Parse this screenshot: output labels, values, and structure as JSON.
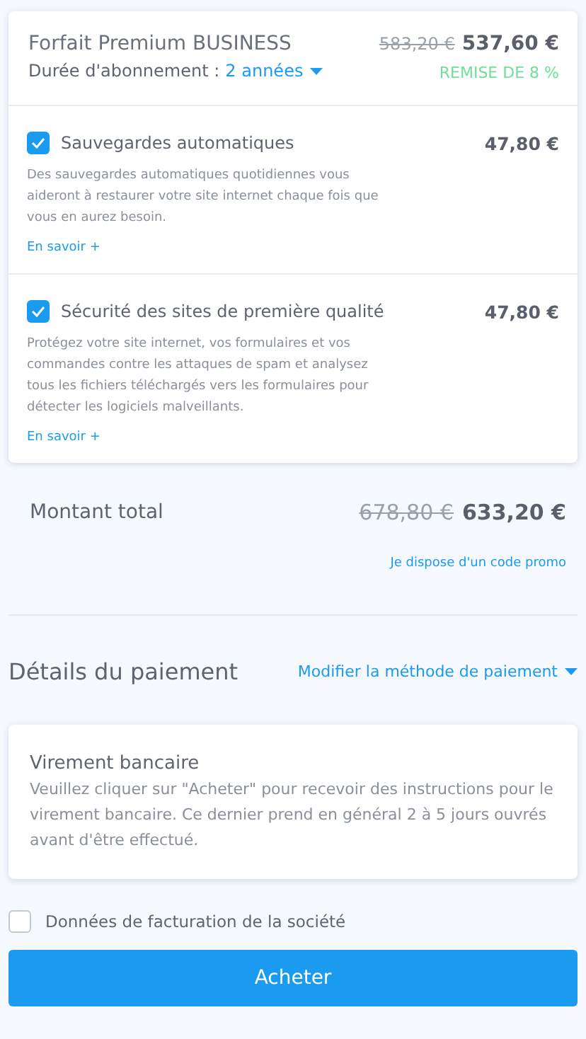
{
  "plan": {
    "name": "Forfait Premium BUSINESS",
    "duration_label": "Durée d'abonnement :",
    "duration_value": "2 années",
    "old_price": "583,20 €",
    "price": "537,60 €",
    "discount": "REMISE DE 8 %"
  },
  "options": [
    {
      "title": "Sauvegardes automatiques",
      "checked": true,
      "price": "47,80 €",
      "description": "Des sauvegardes automatiques quotidiennes vous aideront à restaurer votre site internet chaque fois que vous en aurez besoin.",
      "link": "En savoir +"
    },
    {
      "title": "Sécurité des sites de première qualité",
      "checked": true,
      "price": "47,80 €",
      "description": "Protégez votre site internet, vos formulaires et vos commandes contre les attaques de spam et analysez tous les fichiers téléchargés vers les formulaires pour détecter les logiciels malveillants.",
      "link": "En savoir +"
    }
  ],
  "total": {
    "label": "Montant total",
    "old_price": "678,80 €",
    "price": "633,20 €",
    "promo_link": "Je dispose d'un code promo"
  },
  "payment": {
    "heading": "Détails du paiement",
    "change_link": "Modifier la méthode de paiement",
    "method_title": "Virement bancaire",
    "method_text": "Veuillez cliquer sur \"Acheter\" pour recevoir des instructions pour le virement bancaire. Ce dernier prend en général 2 à 5 jours ouvrés avant d'être effectué."
  },
  "company_billing": {
    "label": "Données de facturation de la société",
    "checked": false
  },
  "buy_button": "Acheter"
}
